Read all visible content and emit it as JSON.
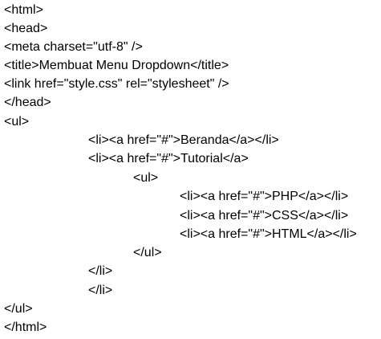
{
  "code": {
    "lines": [
      "<html>",
      "<head>",
      "<meta charset=\"utf-8\" />",
      "<title>Membuat Menu Dropdown</title>",
      "<link href=\"style.css\" rel=\"stylesheet\" />",
      "</head>",
      "<ul>",
      "<li><a href=\"#\">Beranda</a></li>",
      "<li><a href=\"#\">Tutorial</a>",
      "<ul>",
      "<li><a href=\"#\">PHP</a></li>",
      "<li><a href=\"#\">CSS</a></li>",
      "<li><a href=\"#\">HTML</a></li>",
      "</ul>",
      "</li>",
      "</li>",
      "</ul>",
      "</html>"
    ]
  }
}
